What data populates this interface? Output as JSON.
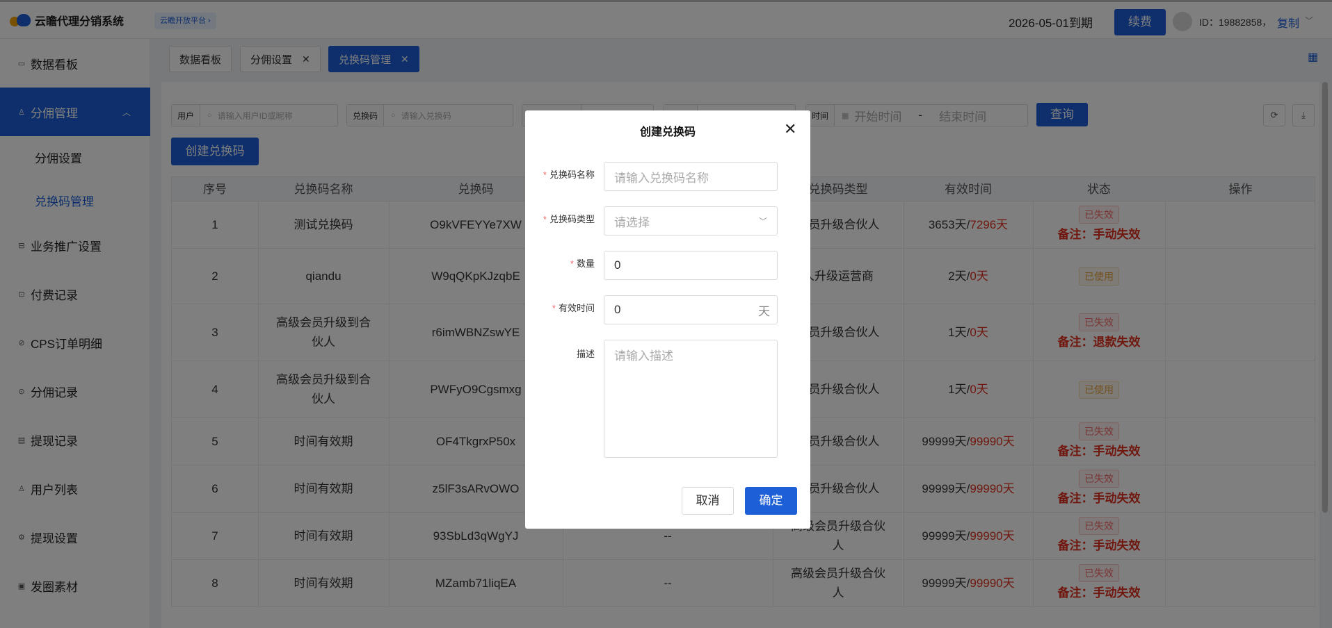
{
  "header": {
    "app_title": "云瞻代理分销系统",
    "platform_badge": "云瞻开放平台 ›",
    "expire_text": "2026-05-01到期",
    "renew_label": "续费",
    "user_id": "ID：19882858，",
    "copy_label": "复制"
  },
  "sidebar": {
    "items": [
      {
        "label": "数据看板",
        "icon": "dashboard-icon"
      },
      {
        "label": "分佣管理",
        "icon": "user-icon"
      },
      {
        "label": "业务推广设置",
        "icon": "briefcase-icon"
      },
      {
        "label": "付费记录",
        "icon": "record-icon"
      },
      {
        "label": "CPS订单明细",
        "icon": "order-icon"
      },
      {
        "label": "分佣记录",
        "icon": "commission-icon"
      },
      {
        "label": "提现记录",
        "icon": "document-icon"
      },
      {
        "label": "用户列表",
        "icon": "person-icon"
      },
      {
        "label": "提现设置",
        "icon": "settings-icon"
      },
      {
        "label": "发圈素材",
        "icon": "material-icon"
      }
    ],
    "sub_items": [
      {
        "label": "分佣设置"
      },
      {
        "label": "兑换码管理"
      }
    ]
  },
  "tabs": [
    {
      "label": "数据看板"
    },
    {
      "label": "分佣设置"
    },
    {
      "label": "兑换码管理"
    }
  ],
  "filters": {
    "user_label": "用户",
    "user_placeholder": "请输入用户ID或昵称",
    "code_label": "兑换码",
    "code_placeholder": "请输入兑换码",
    "time_label": "时间",
    "start_placeholder": "开始时间",
    "separator": "-",
    "end_placeholder": "结束时间",
    "query_label": "查询"
  },
  "create_button": "创建兑换码",
  "table": {
    "columns": [
      "序号",
      "兑换码名称",
      "兑换码",
      "",
      "兑换码类型",
      "有效时间",
      "状态",
      "操作"
    ],
    "rows": [
      {
        "no": "1",
        "name": "测试兑换码",
        "code": "O9kVFEYYe7XW",
        "extra": "",
        "type": "会员升级合伙人",
        "valid_a": "3653天/",
        "valid_b": "7296天",
        "status": "已失效",
        "status_kind": "fail",
        "note": "备注：手动失效"
      },
      {
        "no": "2",
        "name": "qiandu",
        "code": "W9qQKpKJzqbE",
        "extra": "",
        "type": "人升级运营商",
        "valid_a": "2天/",
        "valid_b": "0天",
        "status": "已使用",
        "status_kind": "used",
        "note": ""
      },
      {
        "no": "3",
        "name": "高级会员升级到合伙人",
        "code": "r6imWBNZswYE",
        "extra": "",
        "type": "会员升级合伙人",
        "valid_a": "1天/",
        "valid_b": "0天",
        "status": "已失效",
        "status_kind": "fail",
        "note": "备注：退款失效"
      },
      {
        "no": "4",
        "name": "高级会员升级到合伙人",
        "code": "PWFyO9Cgsmxg",
        "extra": "",
        "type": "会员升级合伙人",
        "valid_a": "1天/",
        "valid_b": "0天",
        "status": "已使用",
        "status_kind": "used",
        "note": ""
      },
      {
        "no": "5",
        "name": "时间有效期",
        "code": "OF4TkgrxP50x",
        "extra": "",
        "type": "会员升级合伙人",
        "valid_a": "99999天/",
        "valid_b": "99990天",
        "status": "已失效",
        "status_kind": "fail",
        "note": "备注：手动失效"
      },
      {
        "no": "6",
        "name": "时间有效期",
        "code": "z5lF3sARvOWO",
        "extra": "",
        "type": "会员升级合伙人",
        "valid_a": "99999天/",
        "valid_b": "99990天",
        "status": "已失效",
        "status_kind": "fail",
        "note": "备注：手动失效"
      },
      {
        "no": "7",
        "name": "时间有效期",
        "code": "93SbLd3qWgYJ",
        "extra": "--",
        "type": "高级会员升级合伙人",
        "valid_a": "99999天/",
        "valid_b": "99990天",
        "status": "已失效",
        "status_kind": "fail",
        "note": "备注：手动失效"
      },
      {
        "no": "8",
        "name": "时间有效期",
        "code": "MZamb71liqEA",
        "extra": "--",
        "type": "高级会员升级合伙人",
        "valid_a": "99999天/",
        "valid_b": "99990天",
        "status": "已失效",
        "status_kind": "fail",
        "note": "备注：手动失效"
      }
    ]
  },
  "modal": {
    "title": "创建兑换码",
    "name_label": "兑换码名称",
    "name_placeholder": "请输入兑换码名称",
    "type_label": "兑换码类型",
    "type_placeholder": "请选择",
    "qty_label": "数量",
    "qty_value": "0",
    "valid_label": "有效时间",
    "valid_value": "0",
    "valid_suffix": "天",
    "desc_label": "描述",
    "desc_placeholder": "请输入描述",
    "cancel_label": "取消",
    "ok_label": "确定",
    "required_mark": "*"
  },
  "colors": {
    "primary": "#1d5fd6",
    "danger": "#e0301e",
    "warning": "#e6a23c"
  }
}
